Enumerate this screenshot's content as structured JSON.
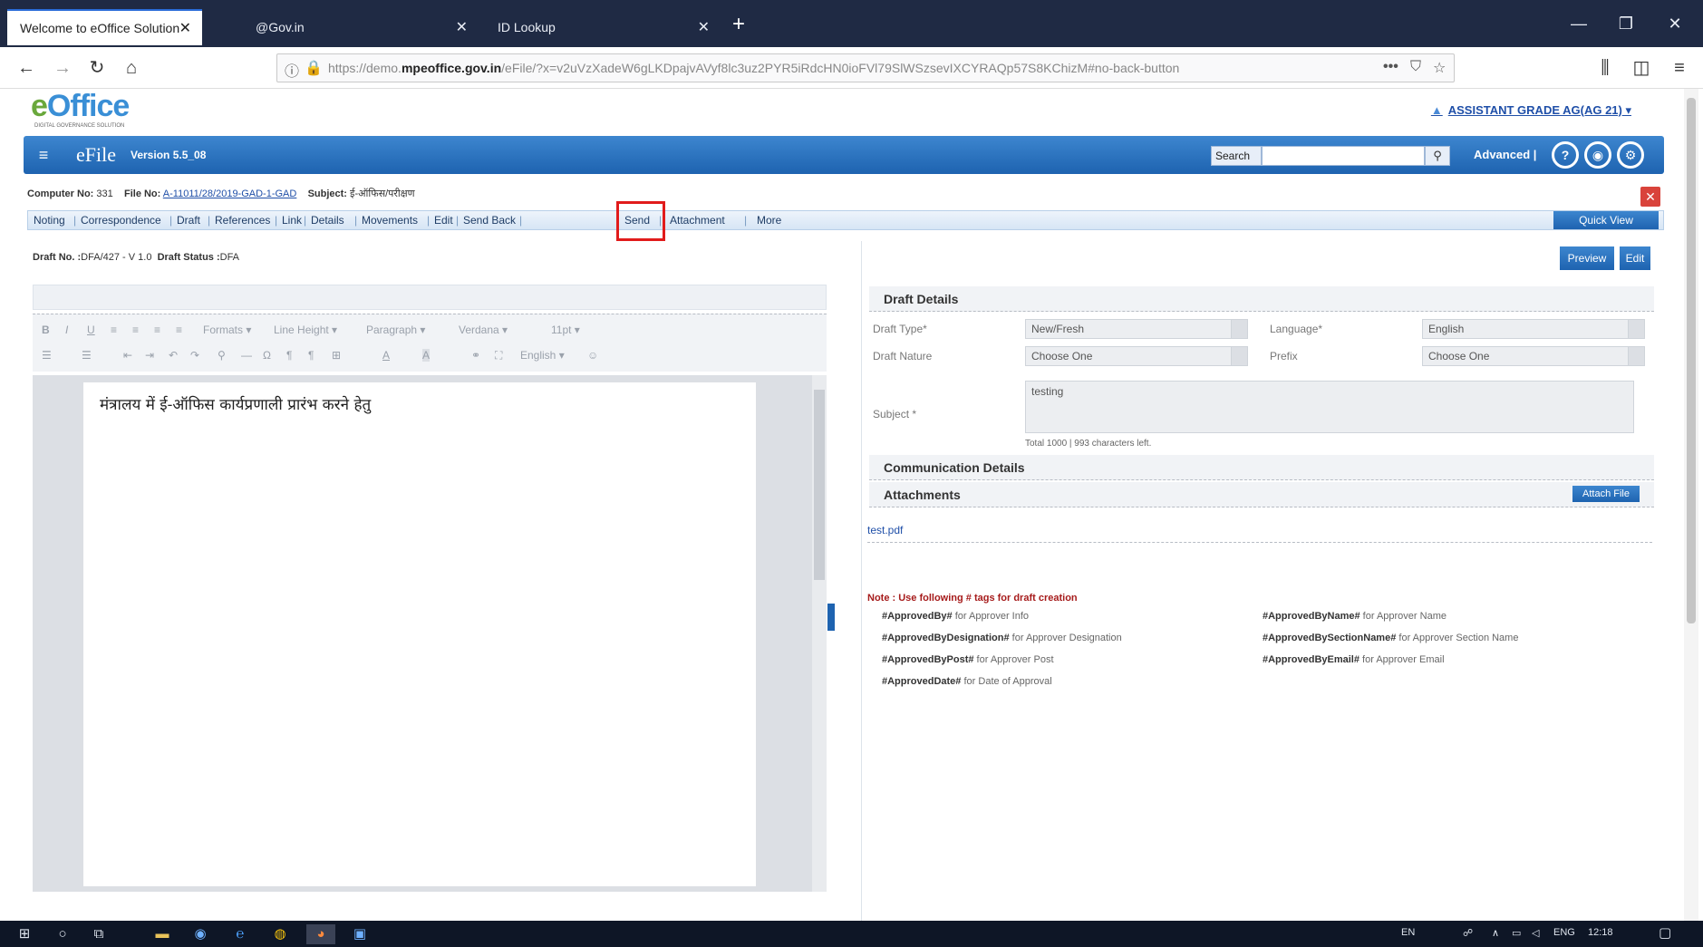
{
  "browser": {
    "tabs": [
      {
        "label": "Welcome to eOffice Solution",
        "active": true
      },
      {
        "label": "@Gov.in",
        "active": false
      },
      {
        "label": "ID Lookup",
        "active": false
      }
    ],
    "new_tab": "+",
    "url_prefix": "https://demo.",
    "url_domain": "mpeoffice.gov.in",
    "url_rest": "/eFile/?x=v2uVzXadeW6gLKDpajvAVyf8lc3uz2PYR5iRdcHN0ioFVl79SlWSzsevIXCYRAQp57S8KChizM#no-back-button",
    "win_controls": [
      "—",
      "❐",
      "✕"
    ]
  },
  "logo": {
    "main": "Office",
    "prefix": "e",
    "subtitle": "DIGITAL GOVERNANCE SOLUTION"
  },
  "user": {
    "label": "ASSISTANT GRADE AG(AG 21)"
  },
  "header": {
    "app_name": "eFile",
    "version": "Version 5.5_08",
    "search_label": "Search",
    "search_value": "",
    "advanced": "Advanced",
    "sep": "|"
  },
  "fileinfo": {
    "computer_no_label": "Computer No:",
    "computer_no": "331",
    "file_no_label": "File No:",
    "file_no": "A-11011/28/2019-GAD-1-GAD",
    "subject_label": "Subject:",
    "subject": "ई-ऑफिस/परीक्षण"
  },
  "menu": {
    "items": [
      "Noting",
      "Correspondence",
      "Draft",
      "References",
      "Link",
      "Details",
      "Movements",
      "Edit",
      "Send Back",
      "Send",
      "Attachment",
      "More"
    ],
    "quick_view": "Quick View"
  },
  "draft": {
    "no_label": "Draft No. :",
    "no_value": "DFA/427 - V 1.0",
    "status_label": "Draft Status :",
    "status_value": "DFA"
  },
  "editor": {
    "toolbar_row1": [
      "B",
      "I",
      "U",
      "≡",
      "≡",
      "≡",
      "≡",
      "Formats",
      "Line Height",
      "Paragraph",
      "Verdana",
      "11pt"
    ],
    "toolbar_row2": [
      "☰",
      "☰",
      "⇤",
      "⇥",
      "↶",
      "↷",
      "⚲",
      "—",
      "Ω",
      "¶",
      "¶",
      "⊞",
      "A",
      "A",
      "⚭",
      "⛶",
      "English",
      "☺"
    ],
    "content": "मंत्रालय में ई-ऑफिस कार्यप्रणाली प्रारंभ करने हेतु"
  },
  "right": {
    "preview": "Preview",
    "edit": "Edit",
    "draft_details": "Draft Details",
    "draft_type_label": "Draft Type*",
    "draft_type": "New/Fresh",
    "language_label": "Language*",
    "language": "English",
    "draft_nature_label": "Draft Nature",
    "draft_nature": "Choose One",
    "prefix_label": "Prefix",
    "prefix": "Choose One",
    "subject_label": "Subject *",
    "subject": "testing",
    "char_count": "Total 1000 | 993 characters left.",
    "communication_details": "Communication Details",
    "attachments": "Attachments",
    "attach_file": "Attach File",
    "attachment_name": "test.pdf",
    "note": "Note : Use following # tags for draft creation",
    "tags": [
      {
        "tag": "#ApprovedBy#",
        "desc": "for Approver Info"
      },
      {
        "tag": "#ApprovedByDesignation#",
        "desc": "for Approver Designation"
      },
      {
        "tag": "#ApprovedByPost#",
        "desc": "for Approver Post"
      },
      {
        "tag": "#ApprovedDate#",
        "desc": "for Date of Approval"
      },
      {
        "tag": "#ApprovedByName#",
        "desc": "for Approver Name"
      },
      {
        "tag": "#ApprovedBySectionName#",
        "desc": "for Approver Section Name"
      },
      {
        "tag": "#ApprovedByEmail#",
        "desc": "for Approver Email"
      }
    ]
  },
  "taskbar": {
    "tray_lang": "EN",
    "tray_kbd": "ENG",
    "time": "12:18"
  }
}
